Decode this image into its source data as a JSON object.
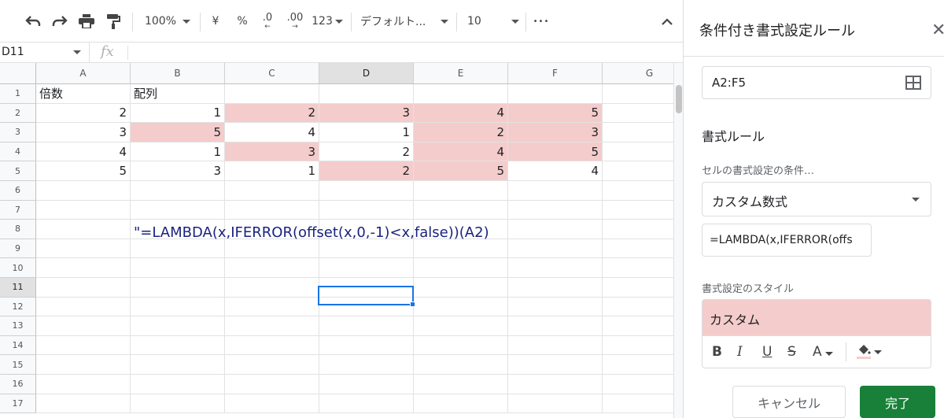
{
  "toolbar": {
    "zoom": "100%",
    "currency": "¥",
    "percent": "%",
    "dec_decrease": ".0",
    "dec_increase": ".00",
    "number_format": "123",
    "font_family": "デフォルト...",
    "font_size": "10",
    "more": "•••"
  },
  "formula_bar": {
    "name_box": "D11",
    "fx": "fx"
  },
  "grid": {
    "columns": [
      "A",
      "B",
      "C",
      "D",
      "E",
      "F",
      "G"
    ],
    "rows": [
      "1",
      "2",
      "3",
      "4",
      "5",
      "6",
      "7",
      "8",
      "9",
      "10",
      "11",
      "12",
      "13",
      "14",
      "15",
      "16",
      "17"
    ],
    "headers": {
      "a1": "倍数",
      "b1": "配列"
    },
    "values": [
      [
        "2",
        "1",
        "2",
        "3",
        "4",
        "5"
      ],
      [
        "3",
        "5",
        "4",
        "1",
        "2",
        "3"
      ],
      [
        "4",
        "1",
        "3",
        "2",
        "4",
        "5"
      ],
      [
        "5",
        "3",
        "1",
        "2",
        "5",
        "4"
      ]
    ],
    "highlighted": [
      [
        false,
        false,
        true,
        true,
        true,
        true
      ],
      [
        false,
        true,
        false,
        false,
        true,
        true
      ],
      [
        false,
        false,
        true,
        false,
        true,
        true
      ],
      [
        false,
        false,
        false,
        true,
        true,
        false
      ]
    ],
    "formula_note": "\"=LAMBDA(x,IFERROR(offset(x,0,-1)<x,false))(A2)",
    "selected_cell": "D11"
  },
  "panel": {
    "title": "条件付き書式設定ルール",
    "range": "A2:F5",
    "section_title": "書式ルール",
    "condition_label": "セルの書式設定の条件…",
    "condition_value": "カスタム数式",
    "formula_value": "=LAMBDA(x,IFERROR(offs",
    "style_label": "書式設定のスタイル",
    "style_preview": "カスタム",
    "style_tools": {
      "bold": "B",
      "italic": "I",
      "underline": "U",
      "strike": "S",
      "text_color": "A"
    },
    "cancel": "キャンセル",
    "done": "完了"
  },
  "colors": {
    "highlight": "#f4cccc",
    "selection": "#1a73e8",
    "done_button": "#188038",
    "formula_text": "#1a237e"
  }
}
